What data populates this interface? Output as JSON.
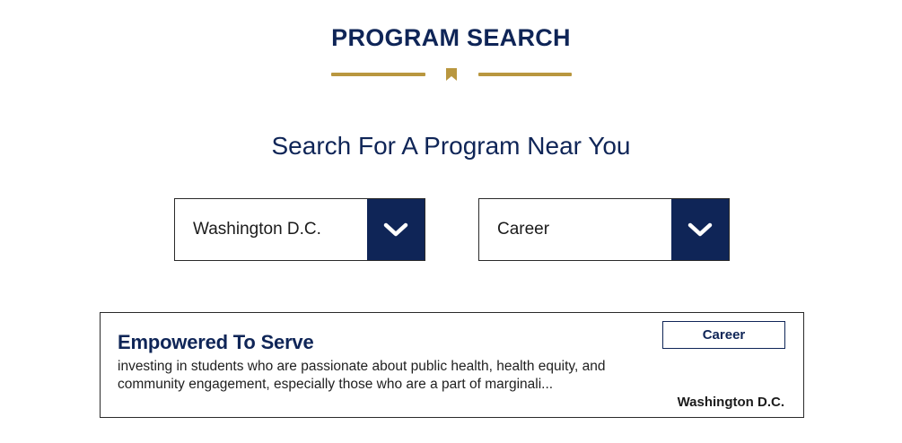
{
  "header": {
    "title": "PROGRAM SEARCH",
    "subtitle": "Search For A Program Near You"
  },
  "colors": {
    "navy": "#0f2557",
    "gold": "#b9973f"
  },
  "filters": {
    "location": {
      "selected": "Washington D.C.",
      "icon": "chevron-down-icon"
    },
    "category": {
      "selected": "Career",
      "icon": "chevron-down-icon"
    }
  },
  "results": [
    {
      "title": "Empowered To Serve",
      "description": "investing in students who are passionate about public health, health equity, and community engagement, especially those who are a part of marginali...",
      "category": "Career",
      "location": "Washington D.C."
    }
  ]
}
